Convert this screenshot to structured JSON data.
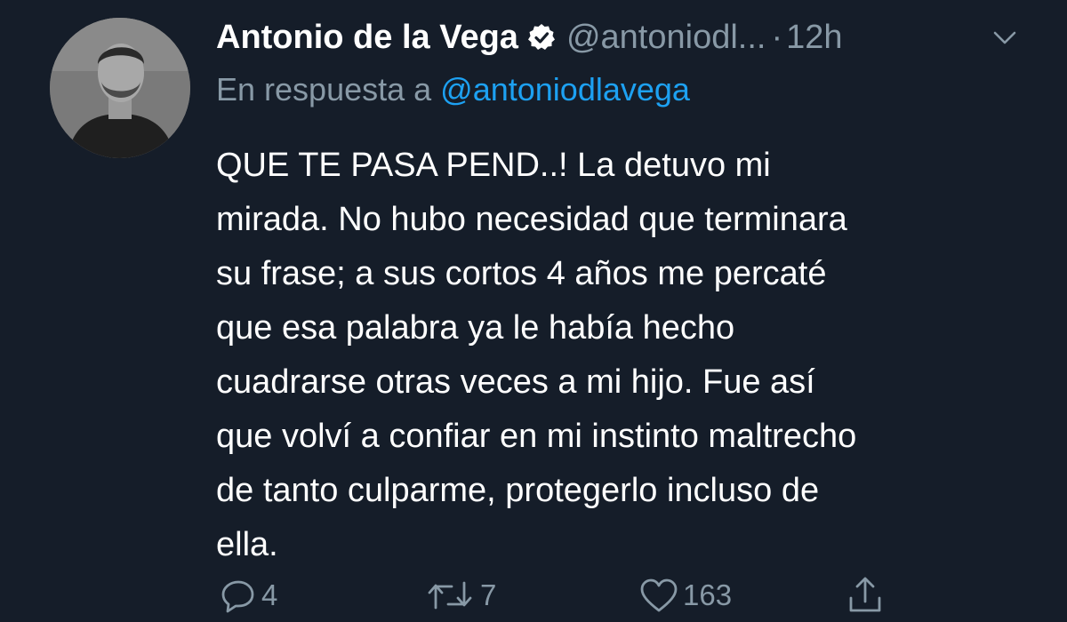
{
  "tweet": {
    "author_name": "Antonio de la Vega",
    "author_handle": "@antoniodl...",
    "separator": "·",
    "time_ago": "12h",
    "reply_prefix": "En respuesta a",
    "reply_mention": "@antoniodlavega",
    "text": "QUE TE PASA PEND..! La detuvo mi\nmirada. No hubo necesidad que terminara\nsu frase; a sus cortos 4 años me percaté\nque esa palabra ya le había hecho\ncuadrarse otras veces a mi hijo. Fue así\nque volví a confiar en mi instinto maltrecho\nde tanto culparme, protegerlo incluso de\nella."
  },
  "actions": {
    "reply_count": "4",
    "retweet_count": "7",
    "like_count": "163"
  },
  "icons": {
    "verified": "verified-badge-icon",
    "caret": "chevron-down-icon",
    "reply": "comment-bubble-icon",
    "retweet": "retweet-arrows-icon",
    "like": "heart-icon",
    "share": "share-upload-icon"
  },
  "colors": {
    "background": "#151d29",
    "primary_text": "#ffffff",
    "secondary_text": "#8899a6",
    "link": "#1da1f2"
  }
}
